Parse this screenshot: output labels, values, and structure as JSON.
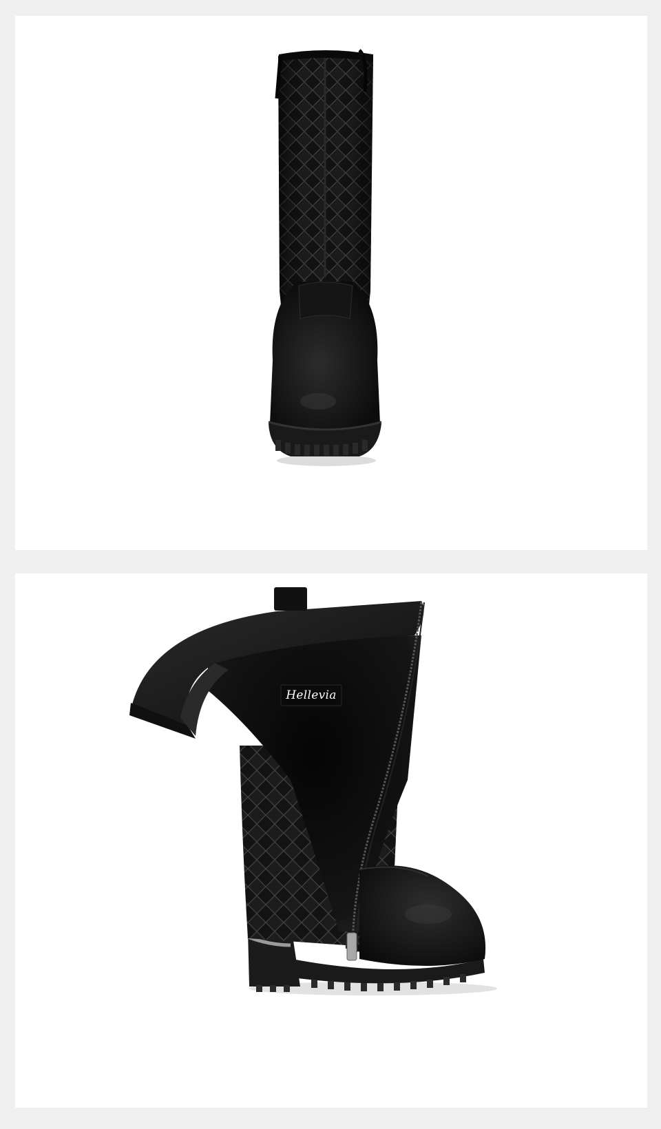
{
  "images": [
    {
      "subject": "boot-front-view"
    },
    {
      "subject": "boot-side-view-open-zipper",
      "label_text": "Hellevia"
    }
  ],
  "colors": {
    "page_background": "#efefef",
    "panel_background": "#ffffff",
    "leather": "#141414",
    "quilt_stitch": "#3a3a3a",
    "fur_lining": "#1c1c1c",
    "metal": "#9a9a9a"
  }
}
